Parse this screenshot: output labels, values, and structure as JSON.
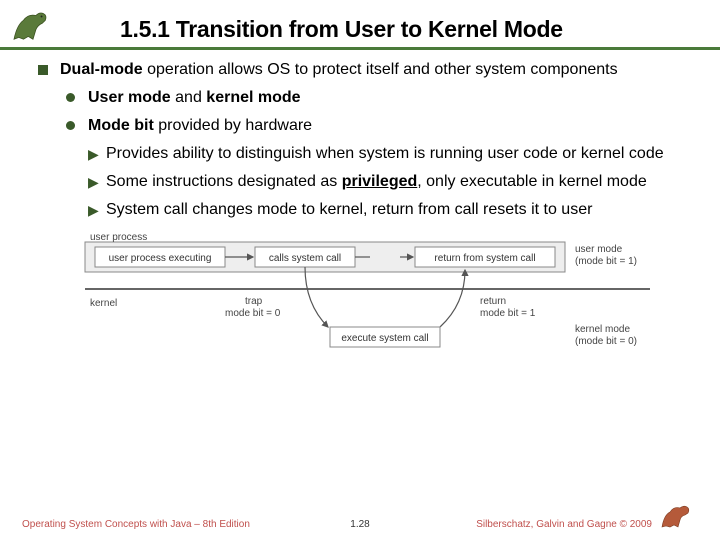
{
  "title": "1.5.1 Transition from User to Kernel Mode",
  "bullets": {
    "main": {
      "pre": "Dual-mode",
      "post": " operation allows OS to protect itself and other system components"
    },
    "sub1": {
      "b1": "User mode",
      "mid": " and ",
      "b2": "kernel mode"
    },
    "sub2": {
      "b1": "Mode bit",
      "post": " provided by hardware"
    },
    "arr1": "Provides ability to distinguish when system is running user code or kernel code",
    "arr2": {
      "pre": "Some instructions designated as ",
      "priv": "privileged",
      "post": ", only executable in kernel mode"
    },
    "arr3": "System call changes mode to kernel, return from call resets it to user"
  },
  "diagram": {
    "top_label": "user process",
    "box1": "user process executing",
    "box2": "calls system call",
    "box3": "return from system call",
    "right_top_1": "user mode",
    "right_top_2": "(mode bit = 1)",
    "mid_left": "kernel",
    "trap": "trap",
    "trap2": "mode bit = 0",
    "return": "return",
    "return2": "mode bit = 1",
    "box4": "execute system call",
    "right_bot_1": "kernel mode",
    "right_bot_2": "(mode bit = 0)"
  },
  "footer": {
    "left": "Operating System Concepts with Java – 8th Edition",
    "center": "1.28",
    "right": "Silberschatz, Galvin and Gagne © 2009"
  }
}
